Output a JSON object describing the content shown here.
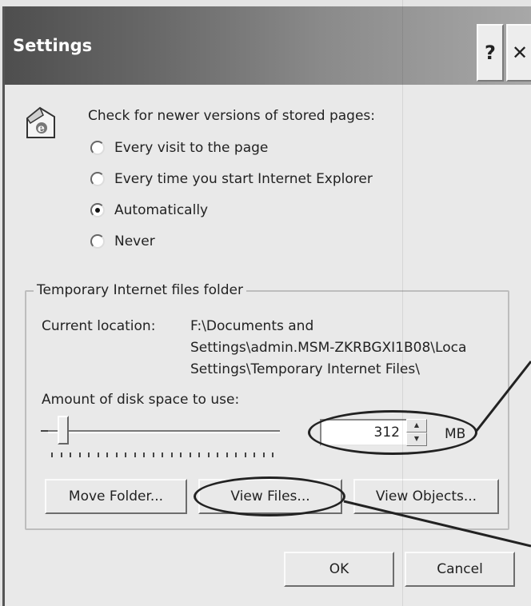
{
  "window": {
    "title": "Settings",
    "help_label": "?",
    "close_label": "✕"
  },
  "check_section": {
    "prompt": "Check for newer versions of stored pages:",
    "icon": "internet-explorer-page-icon",
    "options": [
      {
        "label": "Every visit to the page",
        "checked": false
      },
      {
        "label": "Every time you start Internet Explorer",
        "checked": false
      },
      {
        "label": "Automatically",
        "checked": true
      },
      {
        "label": "Never",
        "checked": false
      }
    ]
  },
  "temp_files": {
    "legend": "Temporary Internet files folder",
    "location_label": "Current location:",
    "location_lines": [
      "F:\\Documents and",
      "Settings\\admin.MSM-ZKRBGXI1B08\\Loca",
      "Settings\\Temporary Internet Files\\"
    ],
    "disk_space_label": "Amount of disk space to use:",
    "disk_space_value": "312",
    "disk_space_unit": "MB",
    "slider_level": 0.05
  },
  "buttons": {
    "move_folder": "Move Folder...",
    "view_files": "View Files...",
    "view_objects": "View Objects...",
    "ok": "OK",
    "cancel": "Cancel"
  },
  "colors": {
    "titlebar_dark": "#4e4e4e",
    "dialog_bg": "#e9e9e9",
    "annotation": "#222222"
  }
}
